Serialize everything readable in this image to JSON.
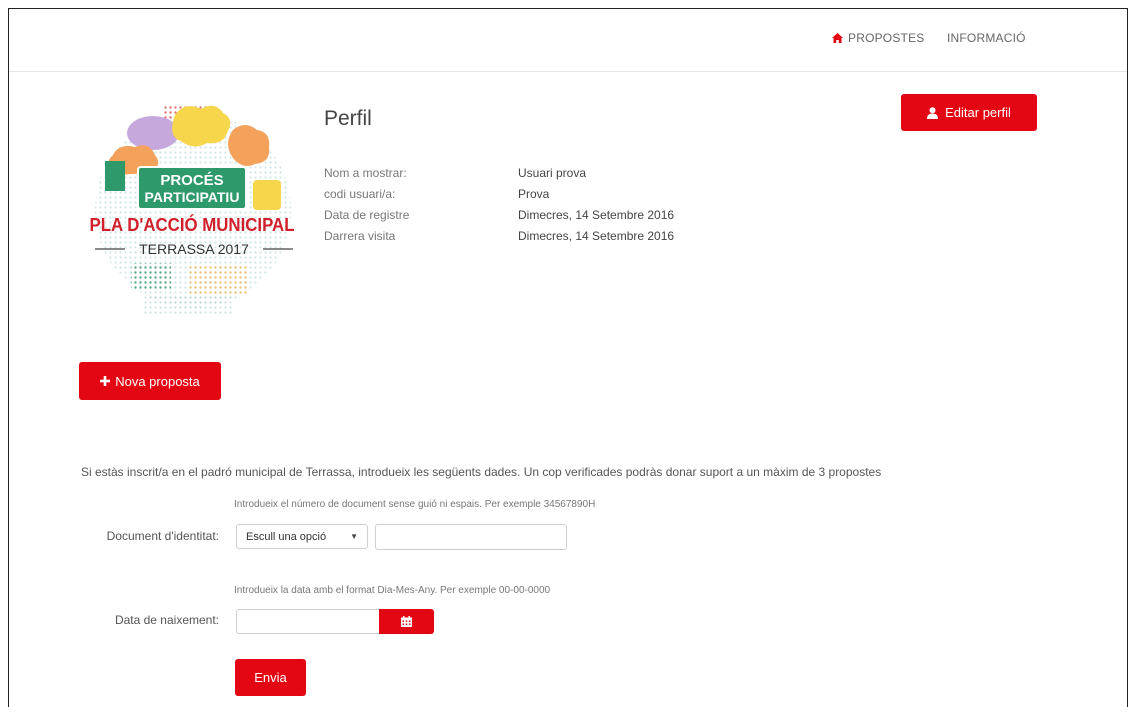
{
  "nav": {
    "items": [
      {
        "label": "PROPOSTES",
        "icon": "home-icon"
      },
      {
        "label": "INFORMACIÓ"
      }
    ]
  },
  "logo": {
    "line1": "PROCÉS",
    "line2": "PARTICIPATIU",
    "line3": "PLA D'ACCIÓ MUNICIPAL",
    "line4": "TERRASSA 2017"
  },
  "profile": {
    "title": "Perfil",
    "fields": [
      {
        "label": "Nom a mostrar:",
        "value": "Usuari prova"
      },
      {
        "label": "codi usuari/a:",
        "value": "Prova"
      },
      {
        "label": "Data de registre",
        "value": "Dimecres, 14 Setembre 2016"
      },
      {
        "label": "Darrera visita",
        "value": "Dimecres, 14 Setembre 2016"
      }
    ]
  },
  "buttons": {
    "edit_profile": "Editar perfil",
    "new_proposal": "Nova proposta",
    "submit": "Envia"
  },
  "form": {
    "intro": "Si estàs inscrit/a en el padró municipal de Terrassa, introdueix les següents dades. Un cop verificades podràs donar suport a un màxim de 3 propostes",
    "doc_hint": "Introdueix el número de document sense guió ni espais. Per exemple 34567890H",
    "doc_label": "Document d'identitat:",
    "doc_select_value": "Escull una opció",
    "doc_input_value": "",
    "date_hint": "Introdueix la data amb el format Dia-Mes-Any. Per exemple 00-00-0000",
    "date_label": "Data de naixement:",
    "date_input_value": ""
  },
  "colors": {
    "accent": "#e30613",
    "logo_green": "#2e9a6b",
    "logo_red": "#d11f2b"
  }
}
